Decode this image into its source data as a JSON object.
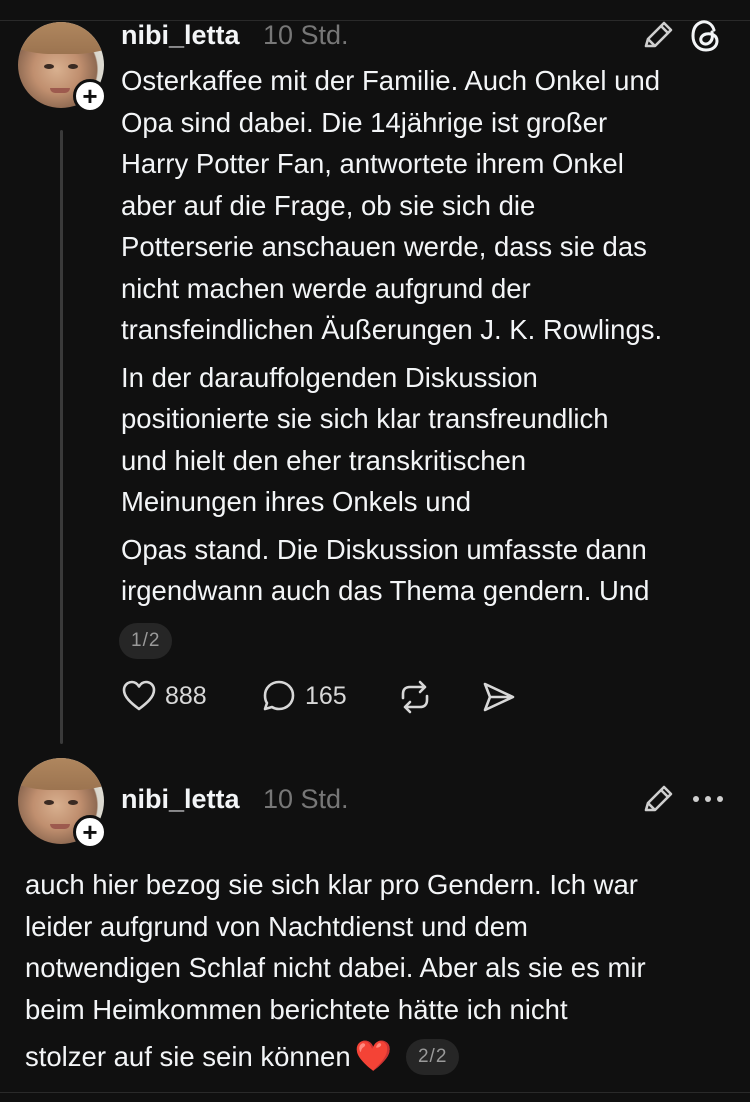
{
  "post1": {
    "username": "nibi_letta",
    "time": "10 Std.",
    "lines": [
      "Osterkaffee mit der Familie. Auch Onkel und",
      "Opa sind dabei. Die 14jährige ist großer",
      "Harry Potter Fan, antwortete ihrem Onkel",
      "aber auf die Frage, ob sie sich die",
      "Potterserie anschauen werde, dass sie das",
      "nicht machen werde aufgrund der",
      "transfeindlichen Äußerungen J. K. Rowlings.",
      "In der darauffolgenden Diskussion",
      "positionierte sie sich klar transfreundlich",
      "und hielt den eher transkritischen",
      "Meinungen ihres Onkels und",
      "Opas stand. Die Diskussion umfasste dann",
      "irgendwann auch das Thema gendern. Und"
    ],
    "page": "1/2",
    "likes": "888",
    "replies": "165",
    "icons": [
      "pencil-icon",
      "threads-icon",
      "heart-icon",
      "comment-icon",
      "repost-icon",
      "share-icon"
    ]
  },
  "post2": {
    "username": "nibi_letta",
    "time": "10 Std.",
    "lines": [
      "auch hier bezog sie sich klar pro Gendern. Ich war",
      "leider aufgrund von Nachtdienst und dem",
      "notwendigen Schlaf nicht dabei. Aber als sie es mir",
      "beim Heimkommen berichtete hätte ich nicht"
    ],
    "last_line": "stolzer auf sie sein können",
    "emoji": "❤️",
    "page": "2/2",
    "icons": [
      "pencil-icon",
      "more-icon"
    ]
  },
  "colors": {
    "background": "#101010",
    "text": "#f3f5f7",
    "muted": "#777777",
    "badge_bg": "#262626"
  }
}
